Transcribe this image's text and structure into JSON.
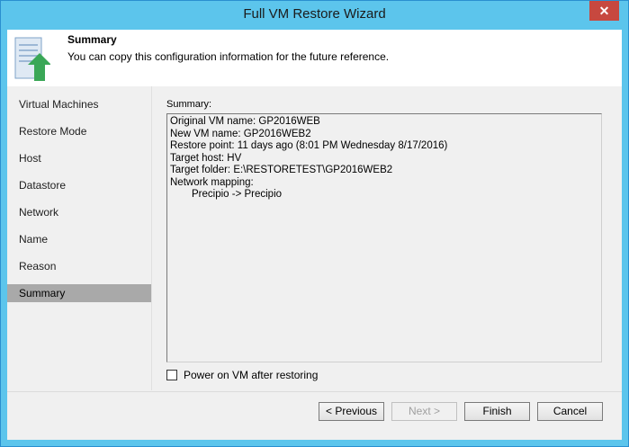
{
  "window": {
    "title": "Full VM Restore Wizard",
    "close_glyph": "✕"
  },
  "header": {
    "title": "Summary",
    "description": "You can copy this configuration information for the future reference.",
    "icon": "restore-arrow-icon",
    "accent_color": "#3aa757"
  },
  "steps": [
    {
      "label": "Virtual Machines"
    },
    {
      "label": "Restore Mode"
    },
    {
      "label": "Host"
    },
    {
      "label": "Datastore"
    },
    {
      "label": "Network"
    },
    {
      "label": "Name"
    },
    {
      "label": "Reason"
    },
    {
      "label": "Summary",
      "active": true
    }
  ],
  "summary": {
    "label": "Summary:",
    "lines": [
      "Original VM name: GP2016WEB",
      "New VM name: GP2016WEB2",
      "Restore point: 11 days ago (8:01 PM Wednesday 8/17/2016)",
      "Target host: HV",
      "Target folder: E:\\RESTORETEST\\GP2016WEB2",
      "Network mapping:",
      "Precipio -> Precipio"
    ]
  },
  "power_on": {
    "label": "Power on VM after restoring",
    "checked": false
  },
  "buttons": {
    "previous": "< Previous",
    "next": "Next >",
    "finish": "Finish",
    "cancel": "Cancel"
  }
}
